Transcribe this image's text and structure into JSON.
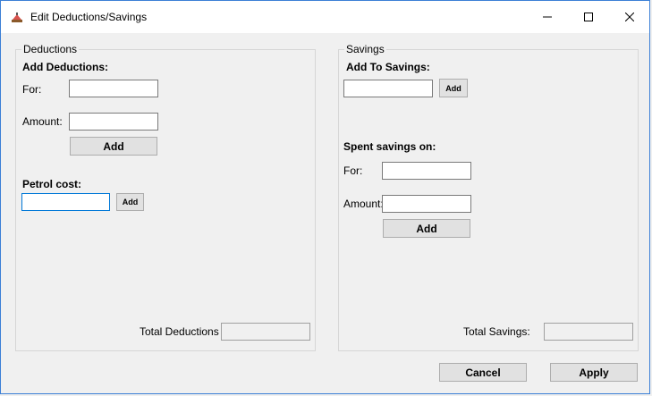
{
  "window": {
    "title": "Edit Deductions/Savings",
    "icons": {
      "app": "app-icon",
      "minimize": "minimize-icon",
      "maximize": "maximize-icon",
      "close": "close-icon"
    }
  },
  "deductions": {
    "group_title": "Deductions",
    "add_heading": "Add Deductions:",
    "for_label": "For:",
    "for_value": "",
    "amount_label": "Amount:",
    "amount_value": "",
    "add_button": "Add",
    "petrol_heading": "Petrol cost:",
    "petrol_value": "",
    "petrol_add_button": "Add",
    "total_label": "Total Deductions",
    "total_value": ""
  },
  "savings": {
    "group_title": "Savings",
    "add_heading": "Add To Savings:",
    "add_value": "",
    "add_button": "Add",
    "spent_heading": "Spent savings on:",
    "for_label": "For:",
    "for_value": "",
    "amount_label": "Amount:",
    "amount_value": "",
    "spent_add_button": "Add",
    "total_label": "Total Savings:",
    "total_value": ""
  },
  "footer": {
    "cancel_button": "Cancel",
    "apply_button": "Apply"
  }
}
